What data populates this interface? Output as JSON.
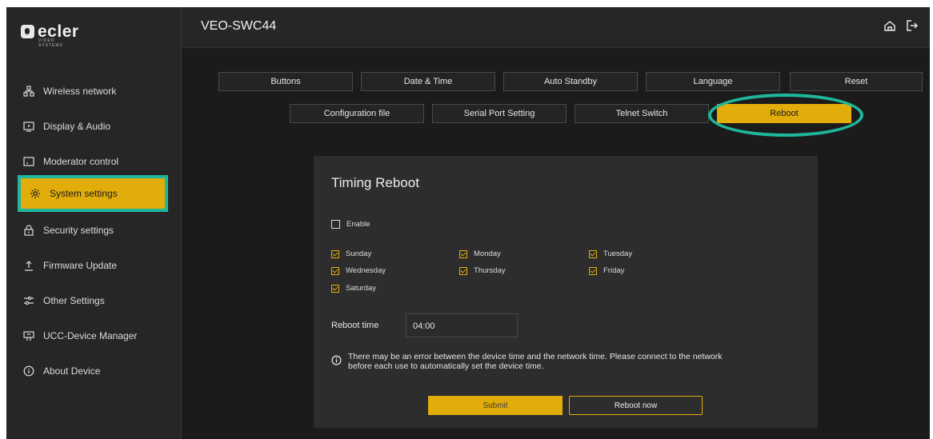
{
  "app": {
    "brand": "ecler",
    "brand_sub": "VIDEO SYSTEMS",
    "title": "VEO-SWC44"
  },
  "colors": {
    "accent": "#e2ad0a",
    "highlight": "#1fb79c",
    "background": "#1b1b1b",
    "panel": "#2d2d2d"
  },
  "sidebar": {
    "items": [
      {
        "label": "Wireless network",
        "icon": "network-icon"
      },
      {
        "label": "Display & Audio",
        "icon": "display-icon"
      },
      {
        "label": "Moderator control",
        "icon": "moderator-icon"
      },
      {
        "label": "System settings",
        "icon": "gear-icon",
        "active": true
      },
      {
        "label": "Security settings",
        "icon": "lock-icon"
      },
      {
        "label": "Firmware Update",
        "icon": "upload-icon"
      },
      {
        "label": "Other Settings",
        "icon": "sliders-icon"
      },
      {
        "label": "UCC-Device Manager",
        "icon": "device-manager-icon"
      },
      {
        "label": "About Device",
        "icon": "info-icon"
      }
    ]
  },
  "header": {
    "icons": [
      "home-icon",
      "logout-icon"
    ]
  },
  "tabs": {
    "row1": [
      "Buttons",
      "Date & Time",
      "Auto Standby",
      "Language",
      "Reset"
    ],
    "row2": [
      "Configuration file",
      "Serial Port Setting",
      "Telnet Switch",
      "Reboot"
    ],
    "active": "Reboot"
  },
  "reboot": {
    "title": "Timing Reboot",
    "enable_label": "Enable",
    "enable_checked": false,
    "days": [
      {
        "label": "Sunday",
        "checked": true
      },
      {
        "label": "Monday",
        "checked": true
      },
      {
        "label": "Tuesday",
        "checked": true
      },
      {
        "label": "Wednesday",
        "checked": true
      },
      {
        "label": "Thursday",
        "checked": true
      },
      {
        "label": "Friday",
        "checked": true
      },
      {
        "label": "Saturday",
        "checked": true
      }
    ],
    "time_label": "Reboot time",
    "time_value": "04:00",
    "info_text_1": "There may be an error between the device time and the network time. Please connect to the network",
    "info_text_2": "before each use to automatically set the device time.",
    "submit_label": "Submit",
    "reboot_now_label": "Reboot now"
  }
}
